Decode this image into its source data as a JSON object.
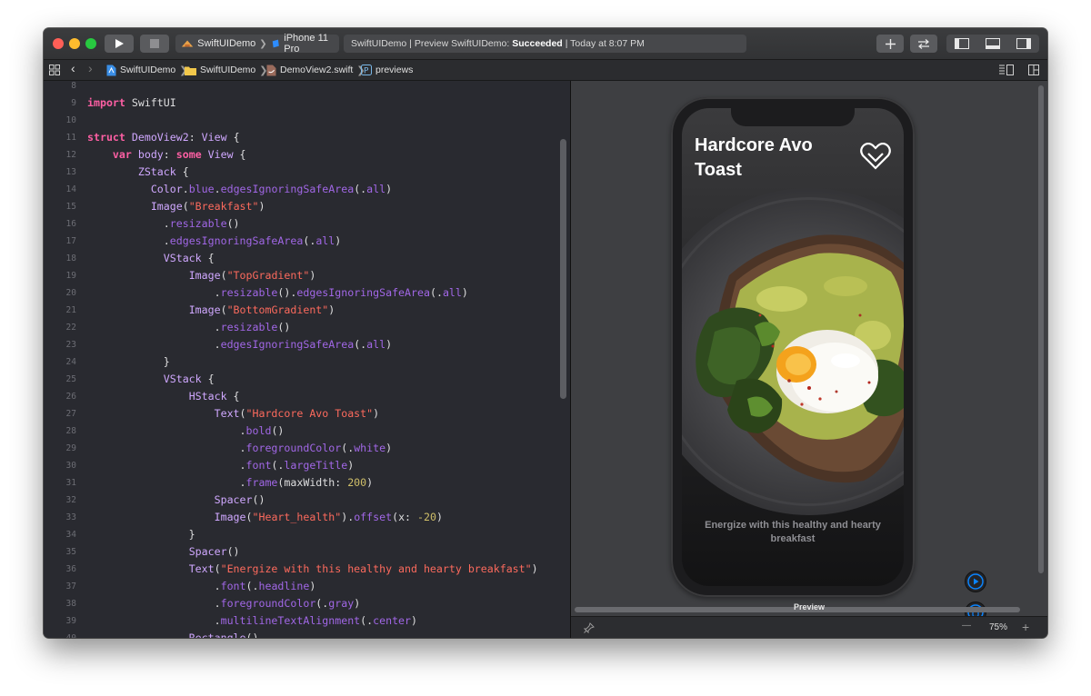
{
  "toolbar": {
    "scheme_project": "SwiftUIDemo",
    "scheme_device": "iPhone 11 Pro",
    "status_prefix": "SwiftUIDemo | Preview SwiftUIDemo:",
    "status_result": "Succeeded",
    "status_suffix": "| Today at 8:07 PM"
  },
  "jumpbar": {
    "items": [
      "SwiftUIDemo",
      "SwiftUIDemo",
      "DemoView2.swift",
      "previews"
    ]
  },
  "editor": {
    "lines": [
      {
        "n": "8",
        "tokens": []
      },
      {
        "n": "9",
        "tokens": [
          [
            "kw",
            "import"
          ],
          [
            "pl",
            " SwiftUI"
          ]
        ]
      },
      {
        "n": "10",
        "tokens": []
      },
      {
        "n": "11",
        "tokens": [
          [
            "kw",
            "struct"
          ],
          [
            "pl",
            " "
          ],
          [
            "ty",
            "DemoView2"
          ],
          [
            "pl",
            ": "
          ],
          [
            "ty",
            "View"
          ],
          [
            "pl",
            " {"
          ]
        ]
      },
      {
        "n": "12",
        "tokens": [
          [
            "pl",
            "    "
          ],
          [
            "kw",
            "var"
          ],
          [
            "pl",
            " "
          ],
          [
            "ty",
            "body"
          ],
          [
            "pl",
            ": "
          ],
          [
            "kw",
            "some"
          ],
          [
            "pl",
            " "
          ],
          [
            "ty",
            "View"
          ],
          [
            "pl",
            " {"
          ]
        ]
      },
      {
        "n": "13",
        "tokens": [
          [
            "pl",
            "        "
          ],
          [
            "ty",
            "ZStack"
          ],
          [
            "pl",
            " {"
          ]
        ]
      },
      {
        "n": "14",
        "tokens": [
          [
            "pl",
            "          "
          ],
          [
            "ty",
            "Color"
          ],
          [
            "pl",
            "."
          ],
          [
            "mb",
            "blue"
          ],
          [
            "pl",
            "."
          ],
          [
            "mb",
            "edgesIgnoringSafeArea"
          ],
          [
            "pl",
            "(."
          ],
          [
            "mb",
            "all"
          ],
          [
            "pl",
            ")"
          ]
        ]
      },
      {
        "n": "15",
        "tokens": [
          [
            "pl",
            "          "
          ],
          [
            "ty",
            "Image"
          ],
          [
            "pl",
            "("
          ],
          [
            "st",
            "\"Breakfast\""
          ],
          [
            "pl",
            ")"
          ]
        ]
      },
      {
        "n": "16",
        "tokens": [
          [
            "pl",
            "            ."
          ],
          [
            "mb",
            "resizable"
          ],
          [
            "pl",
            "()"
          ]
        ]
      },
      {
        "n": "17",
        "tokens": [
          [
            "pl",
            "            ."
          ],
          [
            "mb",
            "edgesIgnoringSafeArea"
          ],
          [
            "pl",
            "(."
          ],
          [
            "mb",
            "all"
          ],
          [
            "pl",
            ")"
          ]
        ]
      },
      {
        "n": "18",
        "tokens": [
          [
            "pl",
            "            "
          ],
          [
            "ty",
            "VStack"
          ],
          [
            "pl",
            " {"
          ]
        ]
      },
      {
        "n": "19",
        "tokens": [
          [
            "pl",
            "                "
          ],
          [
            "ty",
            "Image"
          ],
          [
            "pl",
            "("
          ],
          [
            "st",
            "\"TopGradient\""
          ],
          [
            "pl",
            ")"
          ]
        ]
      },
      {
        "n": "20",
        "tokens": [
          [
            "pl",
            "                    ."
          ],
          [
            "mb",
            "resizable"
          ],
          [
            "pl",
            "()."
          ],
          [
            "mb",
            "edgesIgnoringSafeArea"
          ],
          [
            "pl",
            "(."
          ],
          [
            "mb",
            "all"
          ],
          [
            "pl",
            ")"
          ]
        ]
      },
      {
        "n": "21",
        "tokens": [
          [
            "pl",
            "                "
          ],
          [
            "ty",
            "Image"
          ],
          [
            "pl",
            "("
          ],
          [
            "st",
            "\"BottomGradient\""
          ],
          [
            "pl",
            ")"
          ]
        ]
      },
      {
        "n": "22",
        "tokens": [
          [
            "pl",
            "                    ."
          ],
          [
            "mb",
            "resizable"
          ],
          [
            "pl",
            "()"
          ]
        ]
      },
      {
        "n": "23",
        "tokens": [
          [
            "pl",
            "                    ."
          ],
          [
            "mb",
            "edgesIgnoringSafeArea"
          ],
          [
            "pl",
            "(."
          ],
          [
            "mb",
            "all"
          ],
          [
            "pl",
            ")"
          ]
        ]
      },
      {
        "n": "24",
        "tokens": [
          [
            "pl",
            "            }"
          ]
        ]
      },
      {
        "n": "25",
        "tokens": [
          [
            "pl",
            "            "
          ],
          [
            "ty",
            "VStack"
          ],
          [
            "pl",
            " {"
          ]
        ]
      },
      {
        "n": "26",
        "tokens": [
          [
            "pl",
            "                "
          ],
          [
            "ty",
            "HStack"
          ],
          [
            "pl",
            " {"
          ]
        ]
      },
      {
        "n": "27",
        "tokens": [
          [
            "pl",
            "                    "
          ],
          [
            "ty",
            "Text"
          ],
          [
            "pl",
            "("
          ],
          [
            "st",
            "\"Hardcore Avo Toast\""
          ],
          [
            "pl",
            ")"
          ]
        ]
      },
      {
        "n": "28",
        "tokens": [
          [
            "pl",
            "                        ."
          ],
          [
            "mb",
            "bold"
          ],
          [
            "pl",
            "()"
          ]
        ]
      },
      {
        "n": "29",
        "tokens": [
          [
            "pl",
            "                        ."
          ],
          [
            "mb",
            "foregroundColor"
          ],
          [
            "pl",
            "(."
          ],
          [
            "mb",
            "white"
          ],
          [
            "pl",
            ")"
          ]
        ]
      },
      {
        "n": "30",
        "tokens": [
          [
            "pl",
            "                        ."
          ],
          [
            "mb",
            "font"
          ],
          [
            "pl",
            "(."
          ],
          [
            "mb",
            "largeTitle"
          ],
          [
            "pl",
            ")"
          ]
        ]
      },
      {
        "n": "31",
        "tokens": [
          [
            "pl",
            "                        ."
          ],
          [
            "mb",
            "frame"
          ],
          [
            "pl",
            "(maxWidth: "
          ],
          [
            "nm",
            "200"
          ],
          [
            "pl",
            ")"
          ]
        ]
      },
      {
        "n": "32",
        "tokens": [
          [
            "pl",
            "                    "
          ],
          [
            "ty",
            "Spacer"
          ],
          [
            "pl",
            "()"
          ]
        ]
      },
      {
        "n": "33",
        "tokens": [
          [
            "pl",
            "                    "
          ],
          [
            "ty",
            "Image"
          ],
          [
            "pl",
            "("
          ],
          [
            "st",
            "\"Heart_health\""
          ],
          [
            "pl",
            ")."
          ],
          [
            "mb",
            "offset"
          ],
          [
            "pl",
            "(x: "
          ],
          [
            "nm",
            "-20"
          ],
          [
            "pl",
            ")"
          ]
        ]
      },
      {
        "n": "34",
        "tokens": [
          [
            "pl",
            "                }"
          ]
        ]
      },
      {
        "n": "35",
        "tokens": [
          [
            "pl",
            "                "
          ],
          [
            "ty",
            "Spacer"
          ],
          [
            "pl",
            "()"
          ]
        ]
      },
      {
        "n": "36",
        "tokens": [
          [
            "pl",
            "                "
          ],
          [
            "ty",
            "Text"
          ],
          [
            "pl",
            "("
          ],
          [
            "st",
            "\"Energize with this healthy and hearty breakfast\""
          ],
          [
            "pl",
            ")"
          ]
        ]
      },
      {
        "n": "37",
        "tokens": [
          [
            "pl",
            "                    ."
          ],
          [
            "mb",
            "font"
          ],
          [
            "pl",
            "(."
          ],
          [
            "mb",
            "headline"
          ],
          [
            "pl",
            ")"
          ]
        ]
      },
      {
        "n": "38",
        "tokens": [
          [
            "pl",
            "                    ."
          ],
          [
            "mb",
            "foregroundColor"
          ],
          [
            "pl",
            "(."
          ],
          [
            "mb",
            "gray"
          ],
          [
            "pl",
            ")"
          ]
        ]
      },
      {
        "n": "39",
        "tokens": [
          [
            "pl",
            "                    ."
          ],
          [
            "mb",
            "multilineTextAlignment"
          ],
          [
            "pl",
            "(."
          ],
          [
            "mb",
            "center"
          ],
          [
            "pl",
            ")"
          ]
        ]
      },
      {
        "n": "40",
        "tokens": [
          [
            "pl",
            "                "
          ],
          [
            "ty",
            "Rectangle"
          ],
          [
            "pl",
            "()"
          ]
        ]
      }
    ]
  },
  "preview": {
    "title": "Hardcore Avo Toast",
    "caption": "Energize with this healthy and hearty breakfast",
    "label": "Preview",
    "zoom": "75%",
    "zoom_out": "—",
    "zoom_in": "+"
  },
  "colors": {
    "keyword": "#fc5fa3",
    "type": "#d0a8ff",
    "member": "#a167e6",
    "string": "#fc6a5d",
    "number": "#d0bf69",
    "accent_blue": "#0a84ff"
  }
}
